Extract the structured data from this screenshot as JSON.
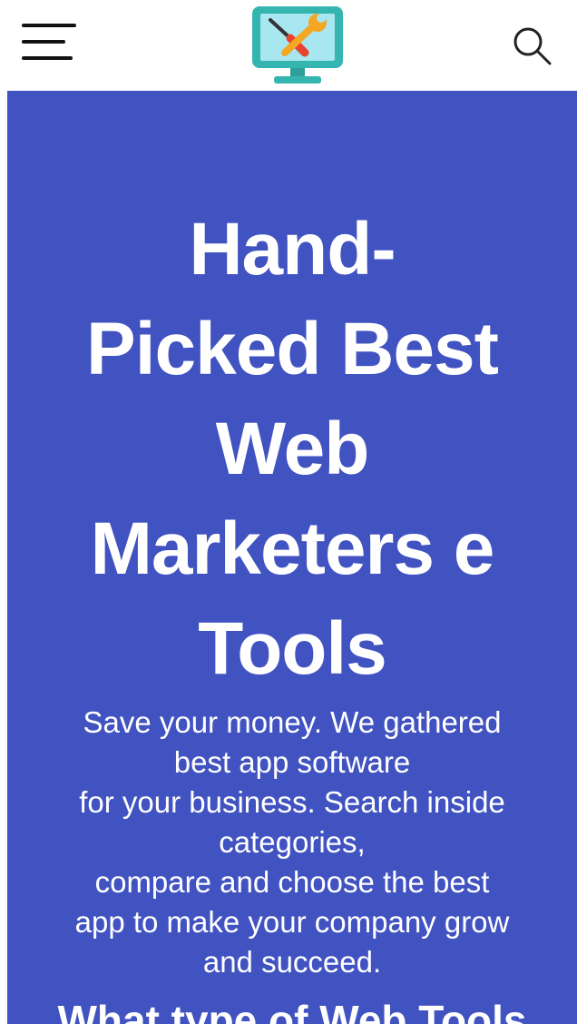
{
  "header": {
    "menu_icon": "hamburger-menu-icon",
    "logo_icon": "monitor-tools-logo-icon",
    "search_icon": "search-icon"
  },
  "hero": {
    "title_lines": [
      "Hand-",
      "Picked Best",
      "Web",
      "Marketers e",
      "Tools"
    ],
    "subtitle_lines": [
      "Save your money. We gathered",
      "best app software",
      "for your business. Search inside",
      "categories,",
      "compare and choose the best",
      "app to make your company grow",
      "and succeed."
    ],
    "next_heading": "What type of Web Tools"
  },
  "colors": {
    "hero_background": "#4152c1",
    "hero_text": "#ffffff",
    "logo_frame": "#35b5b0",
    "logo_screen": "#a8e6f0",
    "logo_wrench": "#f5a623",
    "logo_screwdriver": "#e8432d"
  }
}
